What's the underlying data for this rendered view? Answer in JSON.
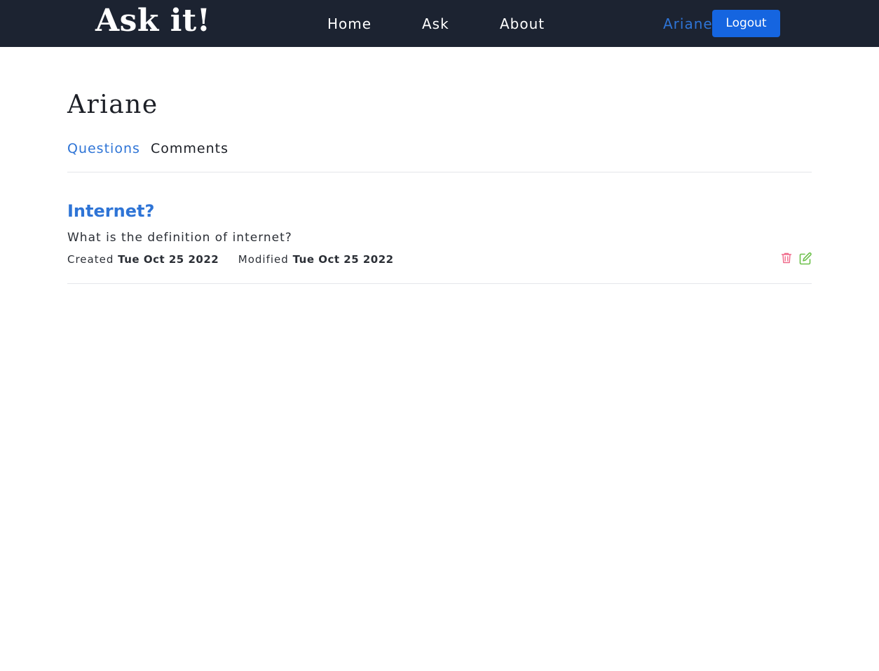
{
  "navbar": {
    "brand": "Ask it!",
    "links": [
      "Home",
      "Ask",
      "About"
    ],
    "user": "Ariane",
    "logout_label": "Logout"
  },
  "profile": {
    "name": "Ariane",
    "tabs": [
      "Questions",
      "Comments"
    ],
    "active_tab": "Questions"
  },
  "questions": [
    {
      "title": "Internet?",
      "body": "What is the definition of internet?",
      "created_label": "Created",
      "created": "Tue Oct 25 2022",
      "modified_label": "Modified",
      "modified": "Tue Oct 25 2022"
    }
  ],
  "icons": {
    "delete": "trash-icon",
    "edit": "edit-icon"
  },
  "colors": {
    "navbar_bg": "#1c2331",
    "accent": "#2e74d6",
    "button": "#1565e0",
    "delete": "#f06a8a",
    "edit": "#6cc04a"
  }
}
